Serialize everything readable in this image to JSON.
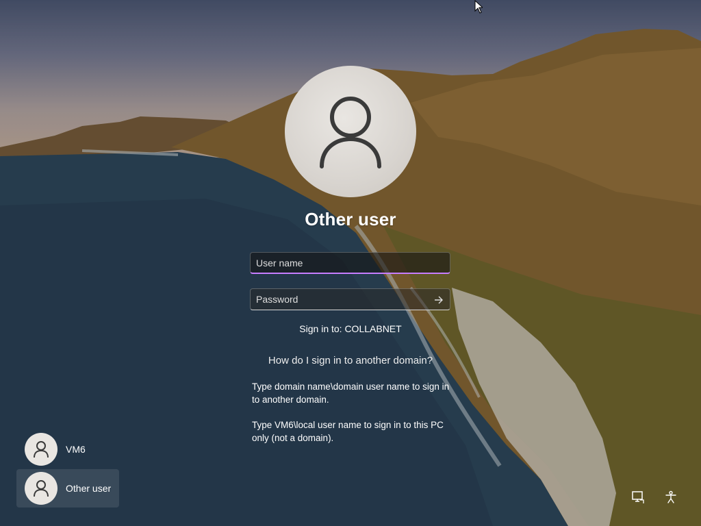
{
  "login": {
    "display_name": "Other user",
    "username_placeholder": "User name",
    "password_placeholder": "Password",
    "sign_in_to": "Sign in to: COLLABNET",
    "help_link": "How do I sign in to another domain?",
    "help_line_1": "Type domain name\\domain user name to sign in to another domain.",
    "help_line_2": "Type VM6\\local user name to sign in to this PC only (not a domain)."
  },
  "users": [
    {
      "label": "VM6",
      "icon": "user-avatar-icon"
    },
    {
      "label": "Other user",
      "icon": "user-avatar-icon"
    }
  ],
  "corner": {
    "network_icon": "network-icon",
    "accessibility_icon": "accessibility-icon"
  },
  "colors": {
    "focus_accent": "#c77dff",
    "avatar_bg": "#e9e6e2",
    "icon_stroke": "#3a3a3a"
  }
}
